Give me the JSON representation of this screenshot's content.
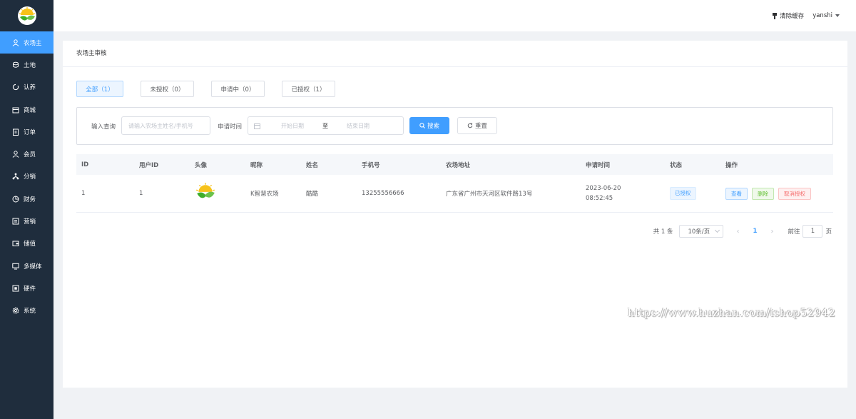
{
  "sidebar": {
    "items": [
      {
        "label": "农场主",
        "icon": "user-icon",
        "active": true
      },
      {
        "label": "土地",
        "icon": "land-icon"
      },
      {
        "label": "认养",
        "icon": "adopt-icon"
      },
      {
        "label": "商城",
        "icon": "shop-icon"
      },
      {
        "label": "订单",
        "icon": "order-icon"
      },
      {
        "label": "会员",
        "icon": "member-icon"
      },
      {
        "label": "分销",
        "icon": "distribution-icon"
      },
      {
        "label": "财务",
        "icon": "finance-icon"
      },
      {
        "label": "营销",
        "icon": "marketing-icon"
      },
      {
        "label": "储值",
        "icon": "wallet-icon"
      },
      {
        "label": "多媒体",
        "icon": "monitor-icon"
      },
      {
        "label": "硬件",
        "icon": "hardware-icon"
      },
      {
        "label": "系统",
        "icon": "gear-icon"
      }
    ]
  },
  "header": {
    "clear_cache": "清除缓存",
    "username": "yanshi"
  },
  "page": {
    "title": "农场主审核"
  },
  "tabs": [
    {
      "label": "全部（1）",
      "active": true
    },
    {
      "label": "未授权（0）"
    },
    {
      "label": "申请中（0）"
    },
    {
      "label": "已授权（1）"
    }
  ],
  "filter": {
    "query_label": "输入查询",
    "query_placeholder": "请输入农场主姓名/手机号",
    "time_label": "申请时间",
    "start_placeholder": "开始日期",
    "range_sep": "至",
    "end_placeholder": "结束日期",
    "search_button": "搜索",
    "reset_button": "重置"
  },
  "table": {
    "columns": [
      "ID",
      "用户ID",
      "头像",
      "昵称",
      "姓名",
      "手机号",
      "农场地址",
      "申请时间",
      "状态",
      "操作"
    ],
    "rows": [
      {
        "id": "1",
        "user_id": "1",
        "nickname": "K智慧农场",
        "name": "酷酷",
        "phone": "13255556666",
        "address": "广东省广州市天河区软件路13号",
        "apply_date": "2023-06-20",
        "apply_time": "08:52:45",
        "status": "已授权",
        "actions": {
          "view": "查看",
          "delete": "删除",
          "revoke": "取消授权"
        }
      }
    ]
  },
  "pagination": {
    "total": "共 1 条",
    "page_size": "10条/页",
    "current_page": "1",
    "goto_label": "前往",
    "goto_value": "1",
    "goto_suffix": "页"
  },
  "watermark": "https://www.huzhan.com/ishop52942"
}
